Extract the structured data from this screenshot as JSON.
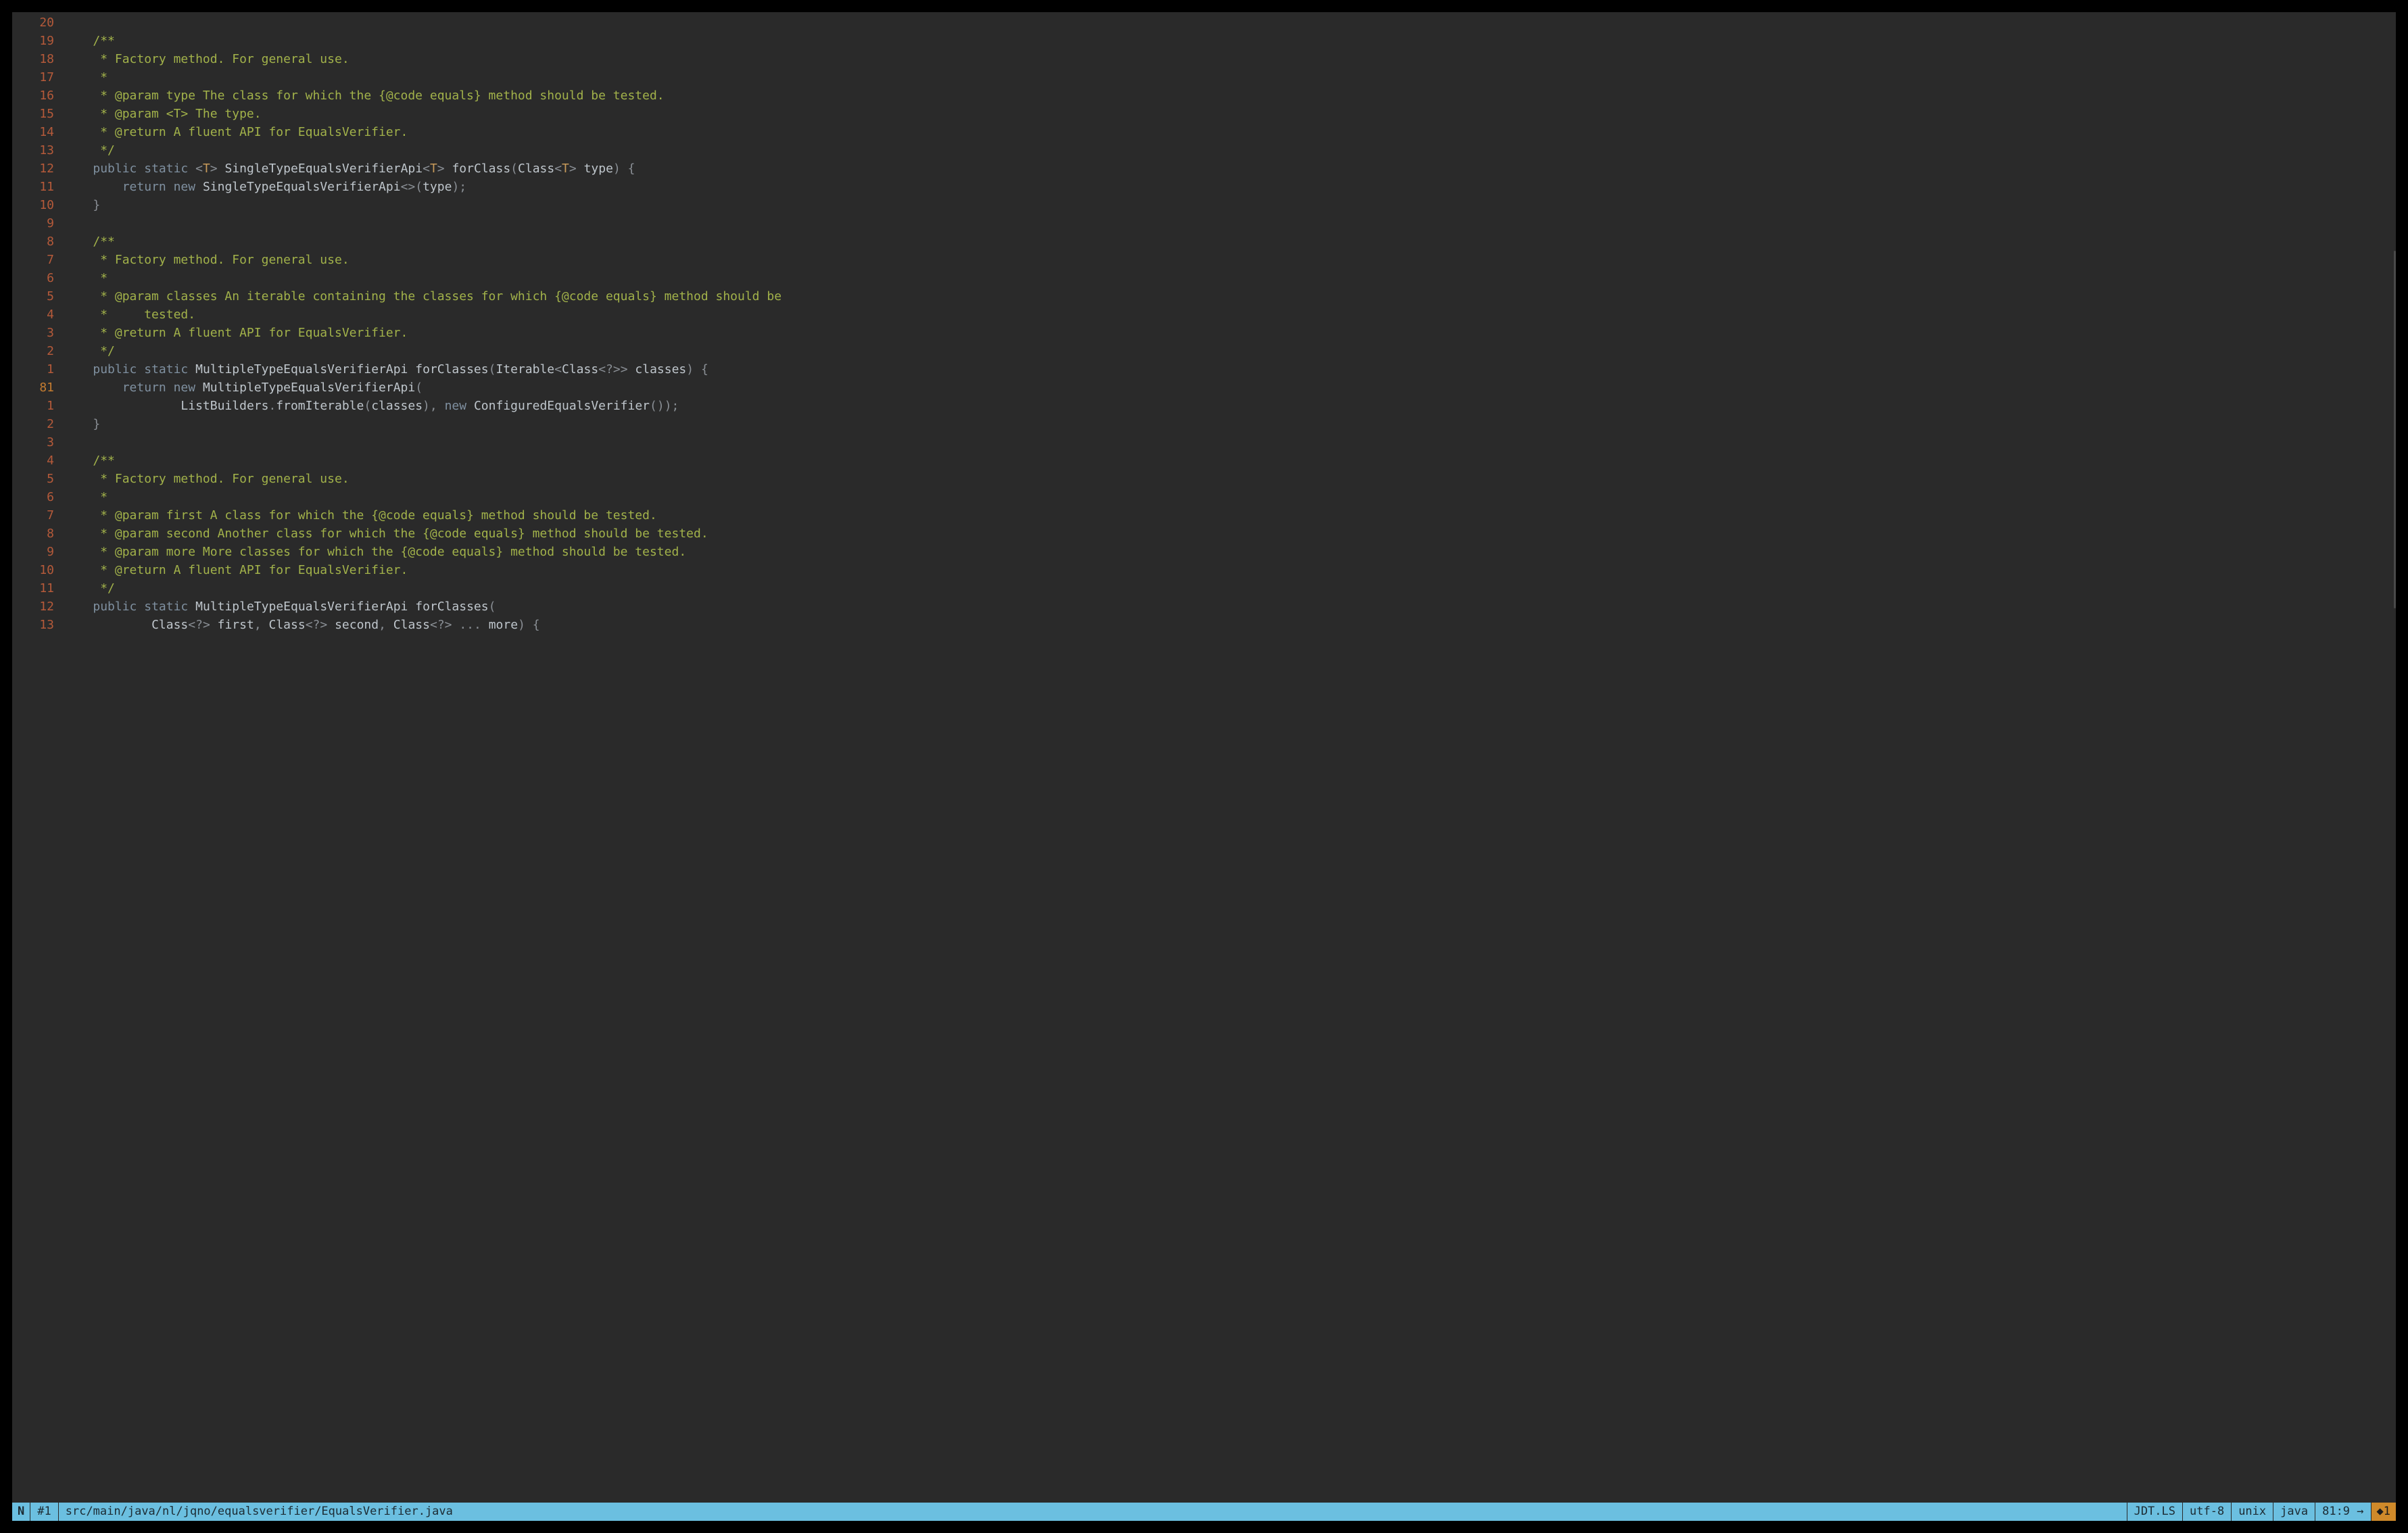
{
  "current_line_abs": 81,
  "lines": [
    {
      "rel": "20",
      "tokens": []
    },
    {
      "rel": "19",
      "tokens": [
        {
          "c": "c-comment",
          "t": "/**"
        }
      ]
    },
    {
      "rel": "18",
      "tokens": [
        {
          "c": "c-comment",
          "t": " * Factory method. For general use."
        }
      ]
    },
    {
      "rel": "17",
      "tokens": [
        {
          "c": "c-comment",
          "t": " *"
        }
      ]
    },
    {
      "rel": "16",
      "tokens": [
        {
          "c": "c-comment",
          "t": " * @param type The class for which the {@code equals} method should be tested."
        }
      ]
    },
    {
      "rel": "15",
      "tokens": [
        {
          "c": "c-comment",
          "t": " * @param <T> The type."
        }
      ]
    },
    {
      "rel": "14",
      "tokens": [
        {
          "c": "c-comment",
          "t": " * @return A fluent API for EqualsVerifier."
        }
      ]
    },
    {
      "rel": "13",
      "tokens": [
        {
          "c": "c-comment",
          "t": " */"
        }
      ]
    },
    {
      "rel": "12",
      "tokens": [
        {
          "c": "c-kw",
          "t": "public"
        },
        {
          "c": "c-plain",
          "t": " "
        },
        {
          "c": "c-kw",
          "t": "static"
        },
        {
          "c": "c-plain",
          "t": " "
        },
        {
          "c": "c-punct",
          "t": "<"
        },
        {
          "c": "c-gen",
          "t": "T"
        },
        {
          "c": "c-punct",
          "t": ">"
        },
        {
          "c": "c-plain",
          "t": " "
        },
        {
          "c": "c-type",
          "t": "SingleTypeEqualsVerifierApi"
        },
        {
          "c": "c-punct",
          "t": "<"
        },
        {
          "c": "c-gen",
          "t": "T"
        },
        {
          "c": "c-punct",
          "t": ">"
        },
        {
          "c": "c-plain",
          "t": " "
        },
        {
          "c": "c-type",
          "t": "forClass"
        },
        {
          "c": "c-punct",
          "t": "("
        },
        {
          "c": "c-type",
          "t": "Class"
        },
        {
          "c": "c-punct",
          "t": "<"
        },
        {
          "c": "c-gen",
          "t": "T"
        },
        {
          "c": "c-punct",
          "t": ">"
        },
        {
          "c": "c-plain",
          "t": " "
        },
        {
          "c": "c-type",
          "t": "type"
        },
        {
          "c": "c-punct",
          "t": ")"
        },
        {
          "c": "c-plain",
          "t": " "
        },
        {
          "c": "c-punct",
          "t": "{"
        }
      ]
    },
    {
      "rel": "11",
      "tokens": [
        {
          "c": "c-plain",
          "t": "    "
        },
        {
          "c": "c-kw",
          "t": "return"
        },
        {
          "c": "c-plain",
          "t": " "
        },
        {
          "c": "c-kw",
          "t": "new"
        },
        {
          "c": "c-plain",
          "t": " "
        },
        {
          "c": "c-type",
          "t": "SingleTypeEqualsVerifierApi"
        },
        {
          "c": "c-punct",
          "t": "<>("
        },
        {
          "c": "c-type",
          "t": "type"
        },
        {
          "c": "c-punct",
          "t": ");"
        }
      ]
    },
    {
      "rel": "10",
      "tokens": [
        {
          "c": "c-punct",
          "t": "}"
        }
      ]
    },
    {
      "rel": "9",
      "tokens": []
    },
    {
      "rel": "8",
      "tokens": [
        {
          "c": "c-comment",
          "t": "/**"
        }
      ]
    },
    {
      "rel": "7",
      "tokens": [
        {
          "c": "c-comment",
          "t": " * Factory method. For general use."
        }
      ]
    },
    {
      "rel": "6",
      "tokens": [
        {
          "c": "c-comment",
          "t": " *"
        }
      ]
    },
    {
      "rel": "5",
      "tokens": [
        {
          "c": "c-comment",
          "t": " * @param classes An iterable containing the classes for which {@code equals} method should be"
        }
      ]
    },
    {
      "rel": "4",
      "tokens": [
        {
          "c": "c-comment",
          "t": " *     tested."
        }
      ]
    },
    {
      "rel": "3",
      "tokens": [
        {
          "c": "c-comment",
          "t": " * @return A fluent API for EqualsVerifier."
        }
      ]
    },
    {
      "rel": "2",
      "tokens": [
        {
          "c": "c-comment",
          "t": " */"
        }
      ]
    },
    {
      "rel": "1",
      "tokens": [
        {
          "c": "c-kw",
          "t": "public"
        },
        {
          "c": "c-plain",
          "t": " "
        },
        {
          "c": "c-kw",
          "t": "static"
        },
        {
          "c": "c-plain",
          "t": " "
        },
        {
          "c": "c-type",
          "t": "MultipleTypeEqualsVerifierApi"
        },
        {
          "c": "c-plain",
          "t": " "
        },
        {
          "c": "c-type",
          "t": "forClasses"
        },
        {
          "c": "c-punct",
          "t": "("
        },
        {
          "c": "c-type",
          "t": "Iterable"
        },
        {
          "c": "c-punct",
          "t": "<"
        },
        {
          "c": "c-type",
          "t": "Class"
        },
        {
          "c": "c-punct",
          "t": "<"
        },
        {
          "c": "c-punct",
          "t": "?"
        },
        {
          "c": "c-punct",
          "t": ">>"
        },
        {
          "c": "c-plain",
          "t": " "
        },
        {
          "c": "c-type",
          "t": "classes"
        },
        {
          "c": "c-punct",
          "t": ")"
        },
        {
          "c": "c-plain",
          "t": " "
        },
        {
          "c": "c-punct",
          "t": "{"
        }
      ]
    },
    {
      "abs": "81",
      "tokens": [
        {
          "c": "c-plain",
          "t": "    "
        },
        {
          "c": "c-kw",
          "t": "return"
        },
        {
          "c": "c-plain",
          "t": " "
        },
        {
          "c": "c-kw",
          "t": "new"
        },
        {
          "c": "c-plain",
          "t": " "
        },
        {
          "c": "c-type",
          "t": "MultipleTypeEqualsVerifierApi"
        },
        {
          "c": "c-punct",
          "t": "("
        }
      ]
    },
    {
      "rel": "1",
      "tokens": [
        {
          "c": "c-plain",
          "t": "            "
        },
        {
          "c": "c-type",
          "t": "ListBuilders"
        },
        {
          "c": "c-punct",
          "t": "."
        },
        {
          "c": "c-call",
          "t": "fromIterable"
        },
        {
          "c": "c-punct",
          "t": "("
        },
        {
          "c": "c-type",
          "t": "classes"
        },
        {
          "c": "c-punct",
          "t": "),"
        },
        {
          "c": "c-plain",
          "t": " "
        },
        {
          "c": "c-kw",
          "t": "new"
        },
        {
          "c": "c-plain",
          "t": " "
        },
        {
          "c": "c-type",
          "t": "ConfiguredEqualsVerifier"
        },
        {
          "c": "c-punct",
          "t": "());"
        }
      ]
    },
    {
      "rel": "2",
      "tokens": [
        {
          "c": "c-punct",
          "t": "}"
        }
      ]
    },
    {
      "rel": "3",
      "tokens": []
    },
    {
      "rel": "4",
      "tokens": [
        {
          "c": "c-comment",
          "t": "/**"
        }
      ]
    },
    {
      "rel": "5",
      "tokens": [
        {
          "c": "c-comment",
          "t": " * Factory method. For general use."
        }
      ]
    },
    {
      "rel": "6",
      "tokens": [
        {
          "c": "c-comment",
          "t": " *"
        }
      ]
    },
    {
      "rel": "7",
      "tokens": [
        {
          "c": "c-comment",
          "t": " * @param first A class for which the {@code equals} method should be tested."
        }
      ]
    },
    {
      "rel": "8",
      "tokens": [
        {
          "c": "c-comment",
          "t": " * @param second Another class for which the {@code equals} method should be tested."
        }
      ]
    },
    {
      "rel": "9",
      "tokens": [
        {
          "c": "c-comment",
          "t": " * @param more More classes for which the {@code equals} method should be tested."
        }
      ]
    },
    {
      "rel": "10",
      "tokens": [
        {
          "c": "c-comment",
          "t": " * @return A fluent API for EqualsVerifier."
        }
      ]
    },
    {
      "rel": "11",
      "tokens": [
        {
          "c": "c-comment",
          "t": " */"
        }
      ]
    },
    {
      "rel": "12",
      "tokens": [
        {
          "c": "c-kw",
          "t": "public"
        },
        {
          "c": "c-plain",
          "t": " "
        },
        {
          "c": "c-kw",
          "t": "static"
        },
        {
          "c": "c-plain",
          "t": " "
        },
        {
          "c": "c-type",
          "t": "MultipleTypeEqualsVerifierApi"
        },
        {
          "c": "c-plain",
          "t": " "
        },
        {
          "c": "c-type",
          "t": "forClasses"
        },
        {
          "c": "c-punct",
          "t": "("
        }
      ]
    },
    {
      "rel": "13",
      "tokens": [
        {
          "c": "c-plain",
          "t": "        "
        },
        {
          "c": "c-type",
          "t": "Class"
        },
        {
          "c": "c-punct",
          "t": "<"
        },
        {
          "c": "c-punct",
          "t": "?"
        },
        {
          "c": "c-punct",
          "t": ">"
        },
        {
          "c": "c-plain",
          "t": " "
        },
        {
          "c": "c-type",
          "t": "first"
        },
        {
          "c": "c-punct",
          "t": ","
        },
        {
          "c": "c-plain",
          "t": " "
        },
        {
          "c": "c-type",
          "t": "Class"
        },
        {
          "c": "c-punct",
          "t": "<"
        },
        {
          "c": "c-punct",
          "t": "?"
        },
        {
          "c": "c-punct",
          "t": ">"
        },
        {
          "c": "c-plain",
          "t": " "
        },
        {
          "c": "c-type",
          "t": "second"
        },
        {
          "c": "c-punct",
          "t": ","
        },
        {
          "c": "c-plain",
          "t": " "
        },
        {
          "c": "c-type",
          "t": "Class"
        },
        {
          "c": "c-punct",
          "t": "<"
        },
        {
          "c": "c-punct",
          "t": "?"
        },
        {
          "c": "c-punct",
          "t": ">"
        },
        {
          "c": "c-plain",
          "t": " "
        },
        {
          "c": "c-punct",
          "t": "..."
        },
        {
          "c": "c-plain",
          "t": " "
        },
        {
          "c": "c-type",
          "t": "more"
        },
        {
          "c": "c-punct",
          "t": ")"
        },
        {
          "c": "c-plain",
          "t": " "
        },
        {
          "c": "c-punct",
          "t": "{"
        }
      ]
    }
  ],
  "code_indent": "    ",
  "statusbar": {
    "mode": "N",
    "buffer": "#1",
    "path": "src/main/java/nl/jqno/equalsverifier/EqualsVerifier.java",
    "lsp": "JDT.LS",
    "encoding": "utf-8",
    "eol": "unix",
    "filetype": "java",
    "position": "81:9 →",
    "warn": "◆1"
  },
  "scroll": {
    "top_pct": 16,
    "height_pct": 24
  }
}
